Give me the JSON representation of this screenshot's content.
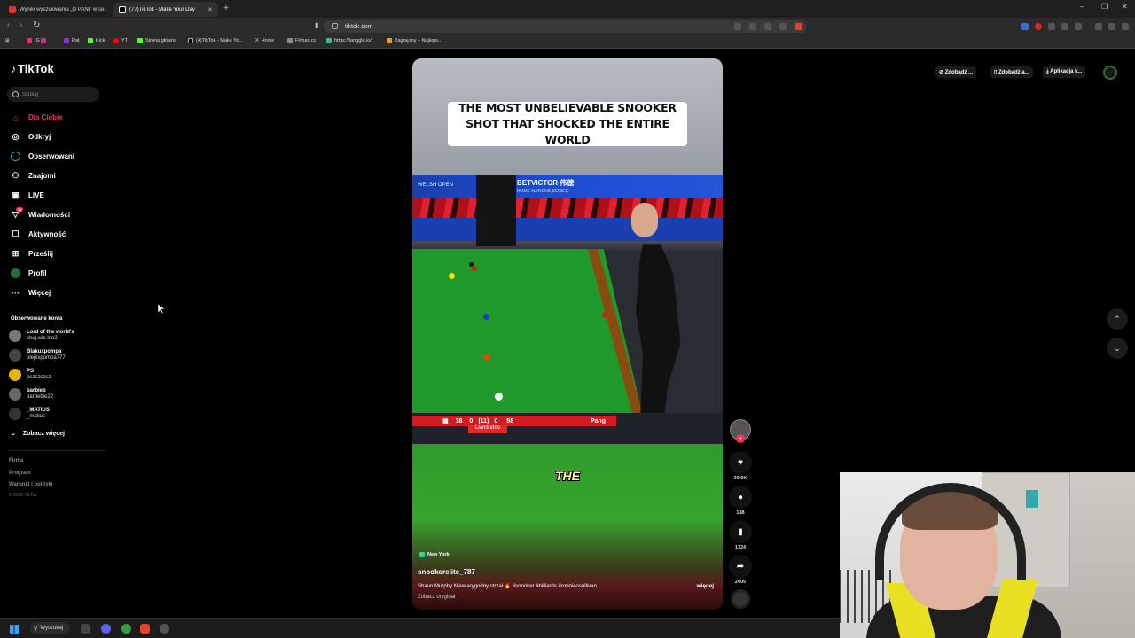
{
  "browser": {
    "tabs": [
      {
        "label": "Wyniki wyszukiwania „O PANI” w se...",
        "active": false
      },
      {
        "label": "(77)TikTok - Make Your Day",
        "active": true
      }
    ],
    "new_tab_label": "+",
    "url": "tiktok.com",
    "bookmarks": [
      "IG",
      "Rat",
      "Kick",
      "YT",
      "Strona główna",
      "(4)TikTok - Make Yo...",
      "Home",
      "Filman.cc",
      "https://tanggle.io/",
      "Zagraj.my – Najleps..."
    ]
  },
  "sidebar": {
    "logo": "TikTok",
    "search_placeholder": "Szukaj",
    "nav": [
      {
        "label": "Dla Ciebie",
        "icon": "home-icon",
        "active": true
      },
      {
        "label": "Odkryj",
        "icon": "compass-icon"
      },
      {
        "label": "Obserwowani",
        "icon": "following-icon"
      },
      {
        "label": "Znajomi",
        "icon": "friends-icon"
      },
      {
        "label": "LIVE",
        "icon": "live-icon"
      },
      {
        "label": "Wiadomości",
        "icon": "messages-icon",
        "badge": "14"
      },
      {
        "label": "Aktywność",
        "icon": "activity-icon"
      },
      {
        "label": "Prześlij",
        "icon": "upload-icon"
      },
      {
        "label": "Profil",
        "icon": "profile-icon"
      },
      {
        "label": "Więcej",
        "icon": "more-icon"
      }
    ],
    "followed_title": "Obserwowane konta",
    "accounts": [
      {
        "name": "Lord of the world's",
        "handle": "chuj.wie.kto2"
      },
      {
        "name": "Blakuxpompa",
        "handle": "blejkxpompa777"
      },
      {
        "name": "PS",
        "handle": "pszszszsz"
      },
      {
        "name": "barbieb",
        "handle": "barbebie22"
      },
      {
        "name": "_MATIUS",
        "handle": "_matius"
      }
    ],
    "see_more": "Zobacz więcej",
    "footer": [
      "Firma",
      "Program",
      "Warunki i polityki"
    ],
    "copyright": "© 2026 TikTok"
  },
  "top_actions": [
    "Zdobądź ...",
    "Zdobądź a...",
    "Aplikacja k..."
  ],
  "video": {
    "overlay_title": "THE MOST UNBELIEVABLE SNOOKER SHOT THAT SHOCKED THE ENTIRE WORLD",
    "banner": "BETVICTOR 伟德",
    "banner_sub": "HOME NATIONS SERIES",
    "banner_left": "WELSH OPEN",
    "scoreboard": {
      "frames_left": "18",
      "score_left": "0",
      "total": "(11)",
      "score_right": "0",
      "break": "58",
      "player": "Pang"
    },
    "venue": "Llandudno",
    "subtitle_word": "THE",
    "location": "New York",
    "author": "snookerelite_787",
    "description": "Shaun Murphy Niewiarygodny strzał 🔥 #snooker #billiards #ronnieosullivan ...",
    "more": "więcej",
    "original": "Zobacz oryginał"
  },
  "actions": {
    "likes": "30.9K",
    "comments": "188",
    "saves": "1724",
    "shares": "2405"
  },
  "taskbar": {
    "search_label": "Wyszukaj"
  },
  "colors": {
    "accent": "#fe2c55",
    "table_green": "#1f9a2a"
  }
}
